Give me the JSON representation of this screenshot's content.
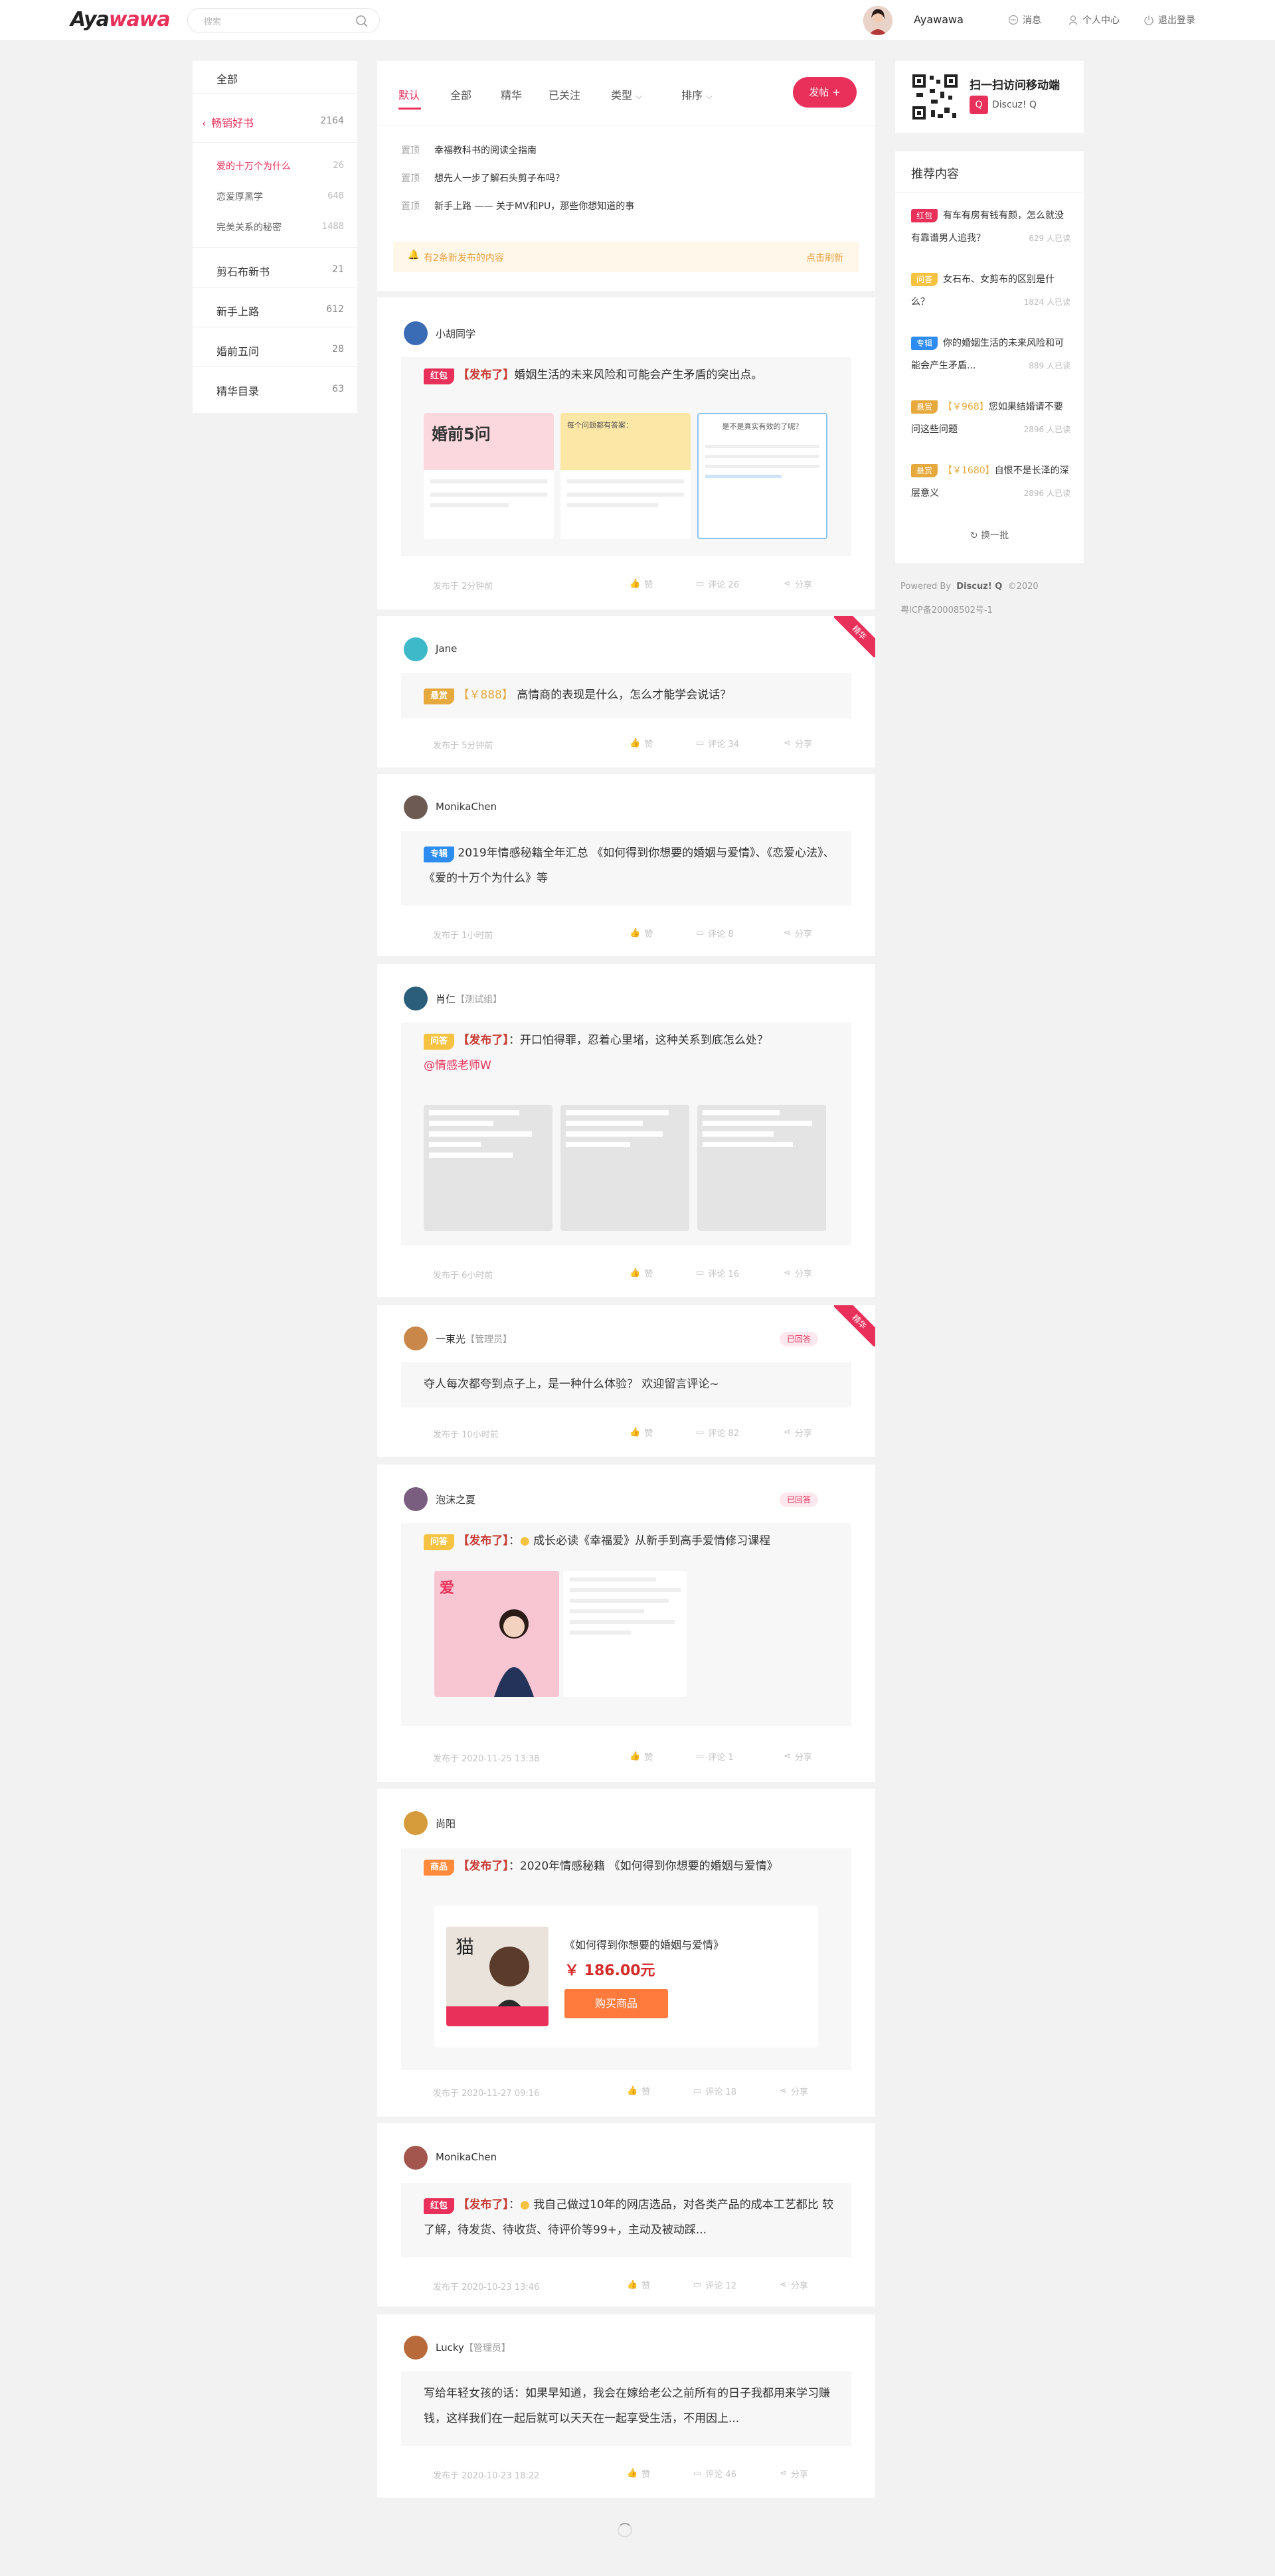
{
  "header": {
    "logo_a": "Aya",
    "logo_b": "wawa",
    "search_placeholder": "搜索",
    "username": "Ayawawa",
    "nav": [
      "消息",
      "个人中心",
      "退出登录"
    ]
  },
  "left_nav": {
    "all": "全部",
    "category": {
      "label": "畅销好书",
      "count": "2164"
    },
    "subs": [
      {
        "label": "爱的十万个为什么",
        "count": "26"
      },
      {
        "label": "恋爱厚黑学",
        "count": "648"
      },
      {
        "label": "完美关系的秘密",
        "count": "1488"
      }
    ],
    "items": [
      {
        "label": "剪石布新书",
        "count": "21"
      },
      {
        "label": "新手上路",
        "count": "612"
      },
      {
        "label": "婚前五问",
        "count": "28"
      },
      {
        "label": "精华目录",
        "count": "63"
      }
    ]
  },
  "tabs": {
    "items": [
      "默认",
      "全部",
      "精华",
      "已关注",
      "类型",
      "排序"
    ],
    "post_button": "发帖 +",
    "pinned_tag": "置顶",
    "pinned": [
      "幸福教科书的阅读全指南",
      "想先人一步了解石头剪子布吗？",
      "新手上路 —— 关于MV和PU，那些你想知道的事"
    ],
    "notice_left": "有2条新发布的内容",
    "notice_right": "点击刷新"
  },
  "posts": [
    {
      "user": "小胡同学",
      "role": "",
      "tag": "红包",
      "prefix": "【发布了】",
      "text": "婚姻生活的未来风险和可能会产生矛盾的突出点。",
      "time": "发布于 2分钟前",
      "like": "赞",
      "comment": "评论 26",
      "share": "分享",
      "img1_title": "婚前5问",
      "img2_title": "每个问题都有答案：",
      "img3_title": "是不是真实有效的了呢？"
    },
    {
      "user": "Jane",
      "role": "",
      "tag": "悬赏",
      "prefix": "【￥888】",
      "text": "高情商的表现是什么，怎么才能学会说话？",
      "time": "发布于 5分钟前",
      "like": "赞",
      "comment": "评论 34",
      "share": "分享",
      "ribbon": "精华"
    },
    {
      "user": "MonikaChen",
      "role": "",
      "tag": "专辑",
      "text": "2019年情感秘籍全年汇总 《如何得到你想要的婚姻与爱情》、《恋爱心法》、《爱的十万个为什么》等",
      "time": "发布于 1小时前",
      "like": "赞",
      "comment": "评论 8",
      "share": "分享"
    },
    {
      "user": "肖仁",
      "role": "【测试组】",
      "tag": "问答",
      "prefix": "【发布了】",
      "text": "：开口怕得罪，忍着心里堵，这种关系到底怎么处？",
      "mention": "@情感老师W",
      "time": "发布于 6小时前",
      "like": "赞",
      "comment": "评论 16",
      "share": "分享"
    },
    {
      "user": "一束光",
      "role": "【管理员】",
      "badge": "已回答",
      "ribbon": "精华",
      "text": "夺人每次都夸到点子上，是一种什么体验？ 欢迎留言评论~",
      "time": "发布于 10小时前",
      "like": "赞",
      "comment": "评论 82",
      "share": "分享"
    },
    {
      "user": "泡沫之夏",
      "role": "",
      "badge": "已回答",
      "tag": "问答",
      "prefix": "【发布了】",
      "text": "成长必读《幸福爱》从新手到高手爱情修习课程",
      "time": "发布于 2020-11-25 13:38",
      "like": "赞",
      "comment": "评论 1",
      "share": "分享",
      "img_title": "爱"
    },
    {
      "user": "尚阳",
      "role": "",
      "tag": "商品",
      "prefix": "【发布了】",
      "text": "：2020年情感秘籍 《如何得到你想要的婚姻与爱情》",
      "product_title": "《如何得到你想要的婚姻与爱情》",
      "price": "￥ 186.00元",
      "buy": "购买商品",
      "time": "发布于 2020-11-27 09:16",
      "like": "赞",
      "comment": "评论 18",
      "share": "分享"
    },
    {
      "user": "MonikaChen",
      "role": "",
      "tag": "红包",
      "prefix": "【发布了】",
      "text": "我自己做过10年的网店选品，对各类产品的成本工艺都比 较了解，待发货、待收货、待评价等99+，主动及被动踩...",
      "time": "发布于 2020-10-23 13:46",
      "like": "赞",
      "comment": "评论 12",
      "share": "分享"
    },
    {
      "user": "Lucky",
      "role": "【管理员】",
      "text": "写给年轻女孩的话：如果早知道，我会在嫁给老公之前所有的日子我都用来学习赚钱，这样我们在一起后就可以天天在一起享受生活，不用因上...",
      "time": "发布于 2020-10-23 18:22",
      "like": "赞",
      "comment": "评论 46",
      "share": "分享"
    }
  ],
  "right": {
    "qr_title": "扫一扫访问移动端",
    "qr_brand": "Discuz! Q",
    "rec_title": "推荐内容",
    "rec": [
      {
        "tag": "红包",
        "text": "有车有房有钱有颜，怎么就没有靠谱男人追我？",
        "count": "629 人已读"
      },
      {
        "tag": "问答",
        "text": "女石布、女剪布的区别是什么？",
        "count": "1824 人已读"
      },
      {
        "tag": "专辑",
        "text": "你的婚姻生活的未来风险和可能会产生矛盾...",
        "count": "889 人已读"
      },
      {
        "tag": "悬赏",
        "prefix": "【￥968】",
        "text": "您如果结婚请不要问这些问题",
        "count": "2896 人已读"
      },
      {
        "tag": "悬赏",
        "prefix": "【￥1680】",
        "text": "自恨不是长泽的深层意义",
        "count": "2896 人已读"
      }
    ],
    "refresh": "换一批",
    "powered": "Powered By",
    "powered_brand": "Discuz! Q",
    "year": "©2020",
    "icp": "粤ICP备20008502号-1"
  },
  "colors": {
    "accent": "#e8305a",
    "gold": "#e6a93e",
    "blue": "#2d8cf0",
    "yellow": "#f5c242",
    "orange": "#ff8a3c"
  }
}
